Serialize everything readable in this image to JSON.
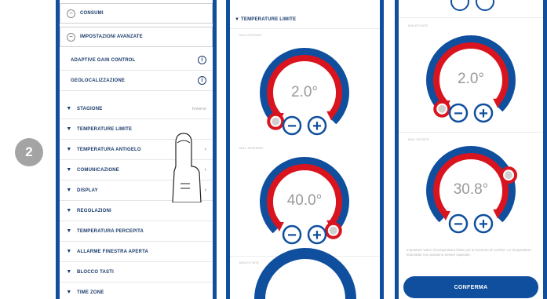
{
  "step_number": "2",
  "colors": {
    "brand_blue": "#0f4f9e",
    "accent_red": "#d9141e",
    "text_dark": "#1a3b6b",
    "text_grey": "#9a9a9a"
  },
  "panel1": {
    "rows": [
      {
        "label": "CONSUMI",
        "icon": "minus-circle-icon"
      },
      {
        "label": "IMPOSTAZIONI AVANZATE",
        "icon": "minus-circle-icon"
      },
      {
        "label": "ADAPTIVE GAIN CONTROL",
        "icon": "info-icon"
      },
      {
        "label": "GEOLOCALIZZAZIONE",
        "icon": "info-icon"
      },
      {
        "label": "STAGIONE",
        "value": "Inverno",
        "icon": "chevron-down-icon"
      },
      {
        "label": "TEMPERATURE LIMITE",
        "icon": "chevron-down-icon"
      },
      {
        "label": "TEMPERATURA ANTIGELO",
        "icon": "chevron-down-icon"
      },
      {
        "label": "COMUNICAZIONE",
        "icon": "chevron-down-icon"
      },
      {
        "label": "DISPLAY",
        "icon": "chevron-down-icon"
      },
      {
        "label": "REGOLAZIONI",
        "icon": "chevron-down-icon"
      },
      {
        "label": "TEMPERATURA PERCEPITA",
        "icon": "chevron-down-icon"
      },
      {
        "label": "ALLARME FINESTRA APERTA",
        "icon": "chevron-down-icon"
      },
      {
        "label": "BLOCCO TASTI",
        "icon": "chevron-down-icon"
      },
      {
        "label": "TIME ZONE",
        "icon": "chevron-down-icon"
      }
    ]
  },
  "panel2": {
    "section_title": "TEMPERATURE LIMITE",
    "label_min": "MIN INVERNO",
    "label_max": "MAX INVERNO",
    "label_next": "MIN ESTATE",
    "dial_min": {
      "value": "2.0°",
      "fraction": 0.0
    },
    "dial_max": {
      "value": "40.0°",
      "fraction": 1.0
    }
  },
  "panel3": {
    "label_min": "MIN ESTATE",
    "label_max": "MAX ESTATE",
    "dial_min": {
      "value": "2.0°",
      "fraction": 0.0
    },
    "dial_max": {
      "value": "30.8°",
      "fraction": 0.75
    },
    "footnote": "Impostare valori di temperatura limite per la funzione di comfort. Le temperature impostate non potranno essere superate.",
    "confirm_label": "CONFERMA"
  },
  "buttons": {
    "minus": "−",
    "plus": "+"
  }
}
